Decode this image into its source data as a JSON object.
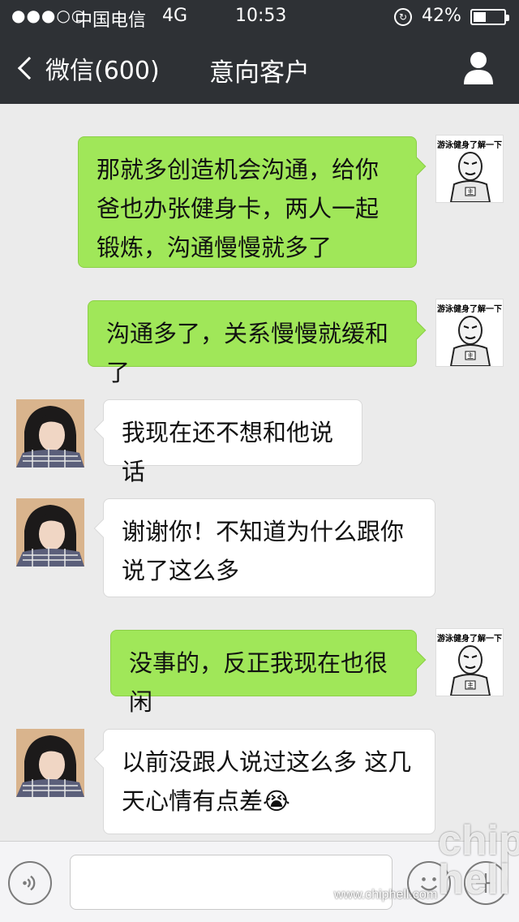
{
  "status_bar": {
    "signal": "●●●○○",
    "carrier": "中国电信",
    "network": "4G",
    "time": "10:53",
    "rotation_lock_icon": "orientation-lock-icon",
    "battery_percent": "42%",
    "battery_level": 0.42
  },
  "nav": {
    "back_label": "微信(600)",
    "title": "意向客户",
    "profile_icon": "person-icon"
  },
  "messages": [
    {
      "side": "right",
      "text": "那就多创造机会沟通，给你爸也办张健身卡，两人一起锻炼，沟通慢慢就多了",
      "avatar_caption": "游泳健身了解一下"
    },
    {
      "side": "right",
      "text": "沟通多了，关系慢慢就缓和了",
      "avatar_caption": "游泳健身了解一下"
    },
    {
      "side": "left",
      "text": "我现在还不想和他说话"
    },
    {
      "side": "left",
      "text": "谢谢你！不知道为什么跟你说了这么多"
    },
    {
      "side": "right",
      "text": "没事的，反正我现在也很闲",
      "avatar_caption": "游泳健身了解一下"
    },
    {
      "side": "left",
      "text": "以前没跟人说过这么多 这几天心情有点差",
      "emoji": "😭"
    }
  ],
  "input_bar": {
    "voice_icon": "voice-icon",
    "emoji_icon": "emoji-icon",
    "plus_icon": "plus-icon"
  },
  "watermark": {
    "logo": "chip hell",
    "url": "www.chiphell.com"
  },
  "colors": {
    "nav_bg": "#2e3135",
    "chat_bg": "#ebebeb",
    "bubble_green": "#a0e759",
    "bubble_white": "#ffffff"
  }
}
